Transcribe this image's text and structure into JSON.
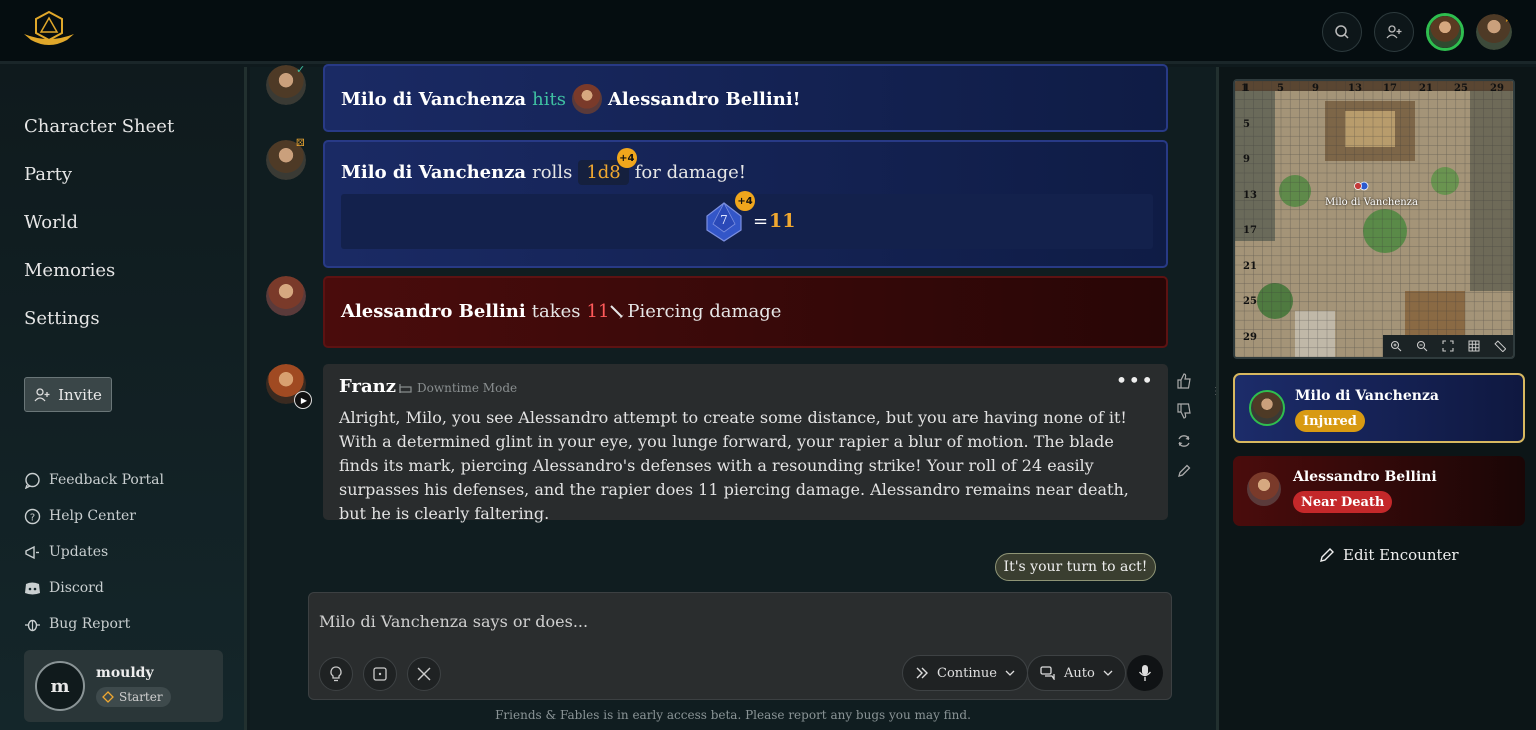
{
  "sidebar": {
    "nav": [
      "Character Sheet",
      "Party",
      "World",
      "Memories",
      "Settings"
    ],
    "invite_label": "Invite",
    "links": [
      "Feedback Portal",
      "Help Center",
      "Updates",
      "Discord",
      "Bug Report"
    ],
    "user": {
      "initial": "m",
      "name": "mouldy",
      "tier": "Starter"
    }
  },
  "chat": {
    "hit": {
      "attacker": "Milo di Vanchenza",
      "verb": "hits",
      "target": "Alessandro Bellini!"
    },
    "roll": {
      "actor": "Milo di Vanchenza",
      "rolls": "rolls",
      "dice": "1d8",
      "suffix": "for damage!",
      "bonus": "+4",
      "die_value": "7",
      "equals": "=",
      "total": "11"
    },
    "damage": {
      "target": "Alessandro Bellini",
      "takes": "takes",
      "amount": "11",
      "type": "Piercing damage"
    },
    "narration": {
      "author": "Franz",
      "mode": "Downtime Mode",
      "text": "Alright, Milo, you see Alessandro attempt to create some distance, but you are having none of it! With a determined glint in your eye, you lunge forward, your rapier a blur of motion. The blade finds its mark, piercing Alessandro's defenses with a resounding strike! Your roll of 24 easily surpasses his defenses, and the rapier does 11 piercing damage. Alessandro remains near death, but he is clearly faltering."
    },
    "turn_prompt": "It's your turn to act!",
    "input_placeholder": "Milo di Vanchenza says or does...",
    "continue_label": "Continue",
    "auto_label": "Auto",
    "footer": "Friends & Fables is in early access beta. Please report any bugs you may find."
  },
  "map": {
    "label": "Milo di Vanchenza",
    "row_labels": [
      "1",
      "5",
      "9",
      "13",
      "17",
      "21",
      "25",
      "29"
    ],
    "col_labels": [
      "1",
      "5",
      "9",
      "13",
      "17",
      "21",
      "25",
      "29"
    ]
  },
  "encounter": [
    {
      "name": "Milo di Vanchenza",
      "status": "Injured",
      "status_color": "#d89a12"
    },
    {
      "name": "Alessandro Bellini",
      "status": "Near Death",
      "status_color": "#c4282a"
    }
  ],
  "edit_encounter_label": "Edit Encounter",
  "colors": {
    "accent_blue": "#1a2a64",
    "teal": "#3fc1a2",
    "gold": "#f0a830",
    "red": "#ff5a5a"
  }
}
